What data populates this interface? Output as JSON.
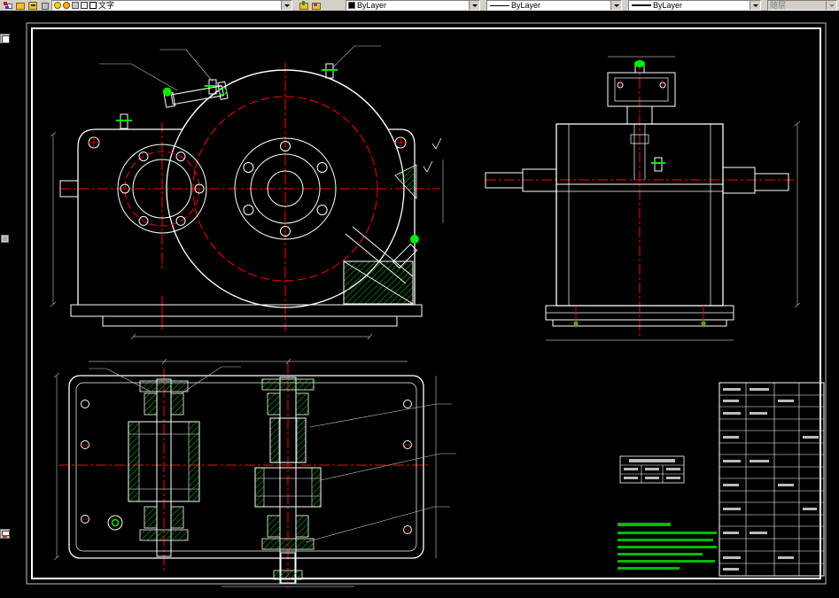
{
  "toolbar": {
    "layer_combo": {
      "value": "文字"
    },
    "color_combo": {
      "value": "ByLayer",
      "swatch_color": "#000000"
    },
    "linetype_combo": {
      "value": "ByLayer"
    },
    "lineweight_combo": {
      "value": "ByLayer"
    },
    "plot_style_combo": {
      "value": "随层"
    }
  },
  "drawing": {
    "colors": {
      "outline": "#ffffff",
      "centerline": "#ff0000",
      "detail_green": "#00ee00",
      "hatch_green": "#00cc00",
      "dimension_gray": "#aaaaaa",
      "notes_green": "#00bb00",
      "sheet_frame": "#ffffff"
    }
  }
}
